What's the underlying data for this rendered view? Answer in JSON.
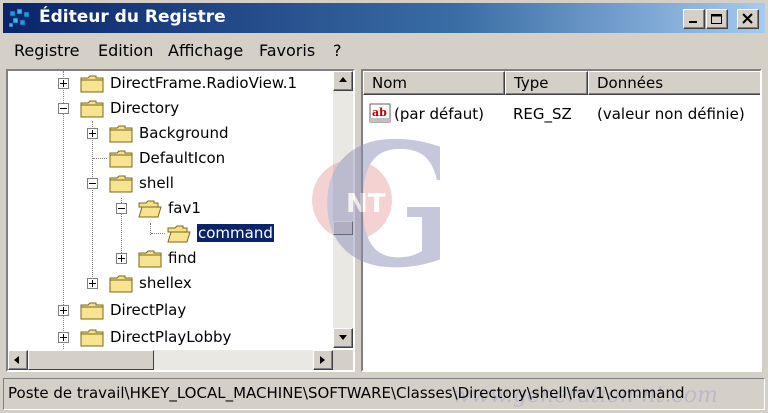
{
  "window": {
    "title": "Éditeur du Registre",
    "controls": {
      "minimize": "minimize",
      "maximize": "maximize",
      "close": "close"
    }
  },
  "menu": [
    {
      "label": "Registre"
    },
    {
      "label": "Edition"
    },
    {
      "label": "Affichage"
    },
    {
      "label": "Favoris"
    },
    {
      "label": "?"
    }
  ],
  "tree": {
    "items": [
      {
        "label": "DirectFrame.RadioView.1",
        "expander": "plus"
      },
      {
        "label": "Directory",
        "expander": "minus"
      },
      {
        "label": "Background",
        "expander": "plus"
      },
      {
        "label": "DefaultIcon",
        "expander": "none"
      },
      {
        "label": "shell",
        "expander": "minus"
      },
      {
        "label": "fav1",
        "expander": "minus"
      },
      {
        "label": "command",
        "expander": "none",
        "selected": true
      },
      {
        "label": "find",
        "expander": "plus"
      },
      {
        "label": "shellex",
        "expander": "plus"
      },
      {
        "label": "DirectPlay",
        "expander": "plus"
      },
      {
        "label": "DirectPlayLobby",
        "expander": "plus"
      }
    ]
  },
  "list": {
    "columns": [
      "Nom",
      "Type",
      "Données"
    ],
    "rows": [
      {
        "name": "(par défaut)",
        "type": "REG_SZ",
        "data": "(valeur non définie)",
        "icon": "string-value-icon"
      }
    ]
  },
  "status": {
    "path": "Poste de travail\\HKEY_LOCAL_MACHINE\\SOFTWARE\\Classes\\Directory\\shell\\fav1\\command"
  },
  "watermark": {
    "letters": "NT",
    "big_letter": "G",
    "url": "www.generation-nt.com"
  },
  "colors": {
    "title_start": "#0a246a",
    "title_end": "#a6caf0",
    "selection": "#0a246a",
    "face": "#d4d0c8"
  }
}
